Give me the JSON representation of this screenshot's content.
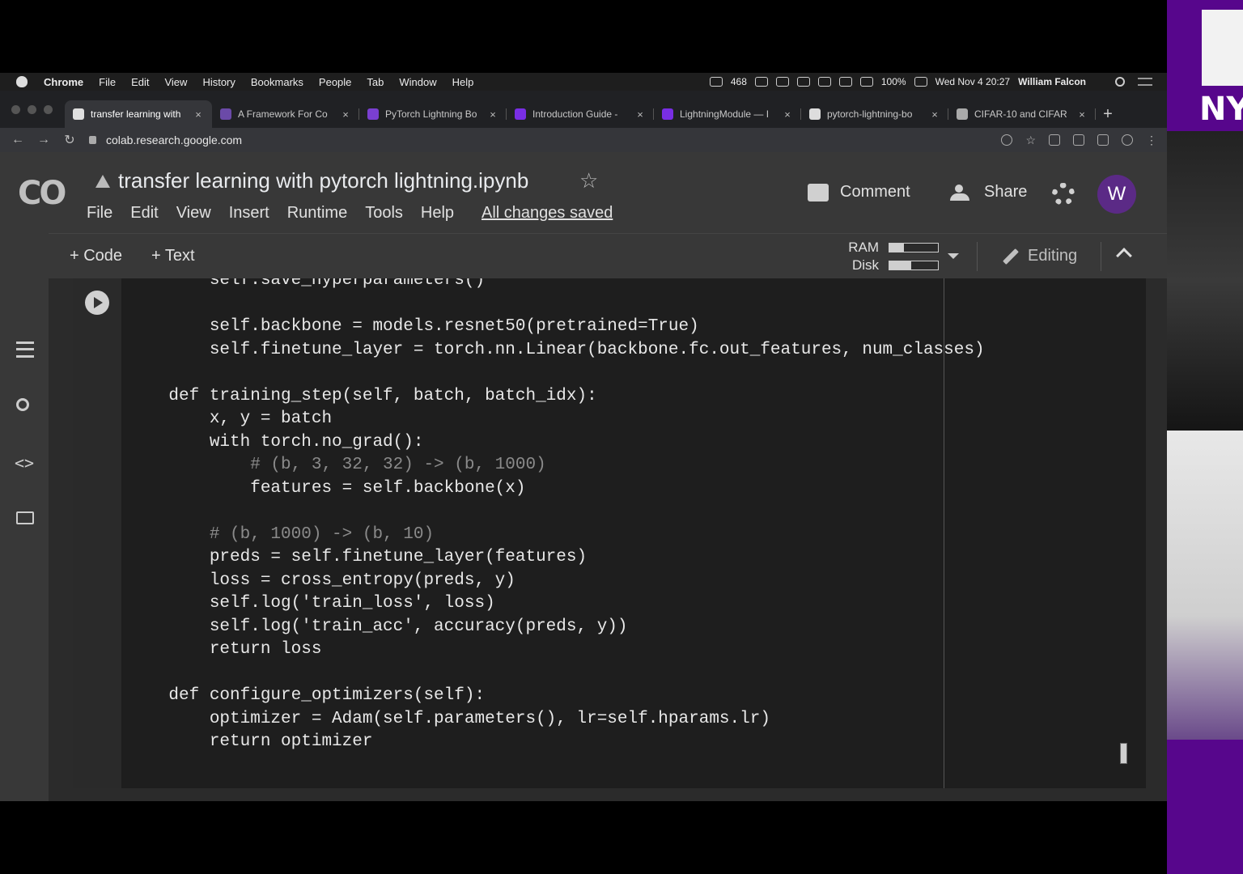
{
  "menubar": {
    "app": "Chrome",
    "items": [
      "File",
      "Edit",
      "View",
      "History",
      "Bookmarks",
      "People",
      "Tab",
      "Window",
      "Help"
    ],
    "mail_count": "468",
    "battery": "100%",
    "datetime": "Wed Nov 4  20:27",
    "user": "William Falcon"
  },
  "tabs": [
    {
      "label": "transfer learning with",
      "favicon_color": "#e0e0e0",
      "active": true
    },
    {
      "label": "A Framework For Co",
      "favicon_color": "#6b4aa8"
    },
    {
      "label": "PyTorch Lightning Bo",
      "favicon_color": "#7a3fd1"
    },
    {
      "label": "Introduction Guide -",
      "favicon_color": "#792ee5"
    },
    {
      "label": "LightningModule — I",
      "favicon_color": "#792ee5"
    },
    {
      "label": "pytorch-lightning-bo",
      "favicon_color": "#dddddd"
    },
    {
      "label": "CIFAR-10 and CIFAR",
      "favicon_color": "#aaaaaa"
    }
  ],
  "tab_close": "×",
  "new_tab": "+",
  "address": {
    "url": "colab.research.google.com"
  },
  "colab": {
    "logo": "CO",
    "title": "transfer learning with pytorch lightning.ipynb",
    "star": "☆",
    "menus": [
      "File",
      "Edit",
      "View",
      "Insert",
      "Runtime",
      "Tools",
      "Help"
    ],
    "saved_status": "All changes saved",
    "comment_label": "Comment",
    "share_label": "Share",
    "avatar_letter": "W",
    "add_code_label": "+ Code",
    "add_text_label": "+ Text",
    "ram_label": "RAM",
    "disk_label": "Disk",
    "ram_usage": 0.3,
    "disk_usage": 0.45,
    "editing_label": "Editing"
  },
  "code_lines": [
    {
      "text": "        self.save_hyperparameters()",
      "comment": false
    },
    {
      "text": "",
      "comment": false
    },
    {
      "text": "        self.backbone = models.resnet50(pretrained=True)",
      "comment": false
    },
    {
      "text": "        self.finetune_layer = torch.nn.Linear(backbone.fc.out_features, num_classes)",
      "comment": false
    },
    {
      "text": "",
      "comment": false
    },
    {
      "text": "    def training_step(self, batch, batch_idx):",
      "comment": false
    },
    {
      "text": "        x, y = batch",
      "comment": false
    },
    {
      "text": "        with torch.no_grad():",
      "comment": false
    },
    {
      "text": "            # (b, 3, 32, 32) -> (b, 1000)",
      "comment": true
    },
    {
      "text": "            features = self.backbone(x)",
      "comment": false
    },
    {
      "text": "",
      "comment": false
    },
    {
      "text": "        # (b, 1000) -> (b, 10)",
      "comment": true
    },
    {
      "text": "        preds = self.finetune_layer(features)",
      "comment": false
    },
    {
      "text": "        loss = cross_entropy(preds, y)",
      "comment": false
    },
    {
      "text": "        self.log('train_loss', loss)",
      "comment": false
    },
    {
      "text": "        self.log('train_acc', accuracy(preds, y))",
      "comment": false
    },
    {
      "text": "        return loss",
      "comment": false
    },
    {
      "text": "",
      "comment": false
    },
    {
      "text": "    def configure_optimizers(self):",
      "comment": false
    },
    {
      "text": "        optimizer = Adam(self.parameters(), lr=self.hparams.lr)",
      "comment": false
    },
    {
      "text": "        return optimizer",
      "comment": false
    }
  ],
  "webcam": {
    "logo_text": "NY"
  }
}
